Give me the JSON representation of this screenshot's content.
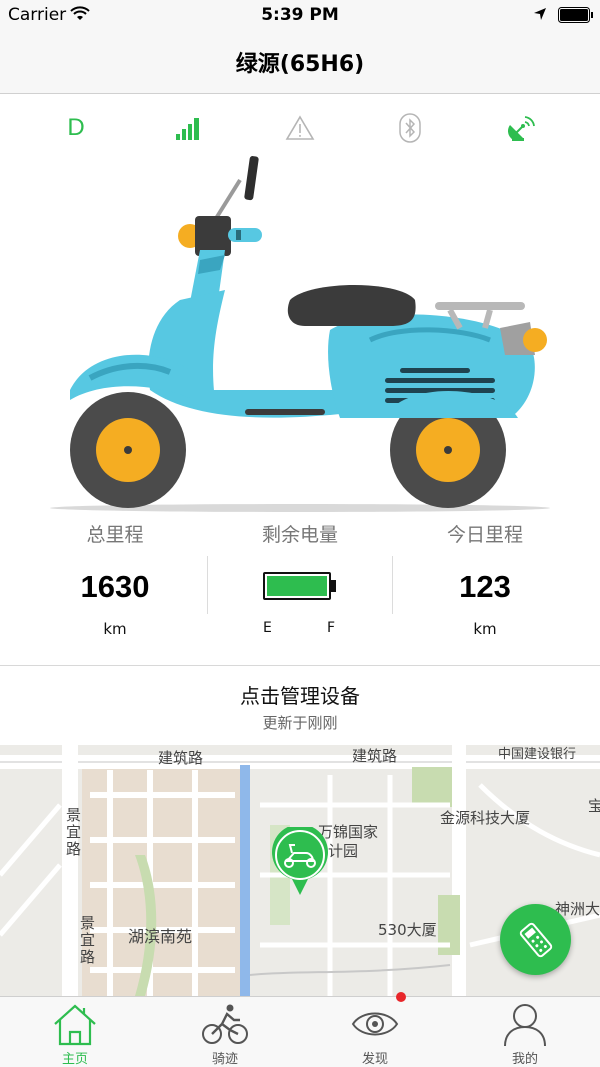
{
  "status_bar": {
    "carrier": "Carrier",
    "time": "5:39 PM"
  },
  "nav": {
    "title": "绿源(65H6)"
  },
  "indicators": {
    "gear": "D",
    "icons": [
      "signal-icon",
      "warning-icon",
      "bluetooth-icon",
      "satellite-icon"
    ],
    "active_color": "#2ebd4f",
    "inactive_color": "#b5b5b5"
  },
  "stats": {
    "total_mileage": {
      "label": "总里程",
      "value": "1630",
      "unit": "km"
    },
    "battery": {
      "label": "剩余电量",
      "level": 1.0,
      "empty_label": "E",
      "full_label": "F"
    },
    "today_mileage": {
      "label": "今日里程",
      "value": "123",
      "unit": "km"
    }
  },
  "manage": {
    "title": "点击管理设备",
    "subtitle": "更新于刚刚"
  },
  "map": {
    "road_top_left": "建筑路",
    "road_top_right": "建筑路",
    "bank": "中国建设银行",
    "road_left_1": "景宜路",
    "road_left_2": "景宜路",
    "residential": "湖滨南苑",
    "park_line1": "万锦国家",
    "park_line2": "计园",
    "building_1": "金源科技大厦",
    "building_2": "530大厦",
    "building_3": "神洲大",
    "building_4": "宝",
    "marker_icon": "scooter-marker-icon",
    "fab_icon": "remote-control-icon"
  },
  "tabbar": {
    "tabs": [
      {
        "label": "主页",
        "icon": "home-icon",
        "active": true
      },
      {
        "label": "骑迹",
        "icon": "cyclist-icon",
        "active": false
      },
      {
        "label": "发现",
        "icon": "eye-icon",
        "active": false
      },
      {
        "label": "我的",
        "icon": "user-icon",
        "active": false
      }
    ],
    "active_color": "#2ebd4f"
  }
}
